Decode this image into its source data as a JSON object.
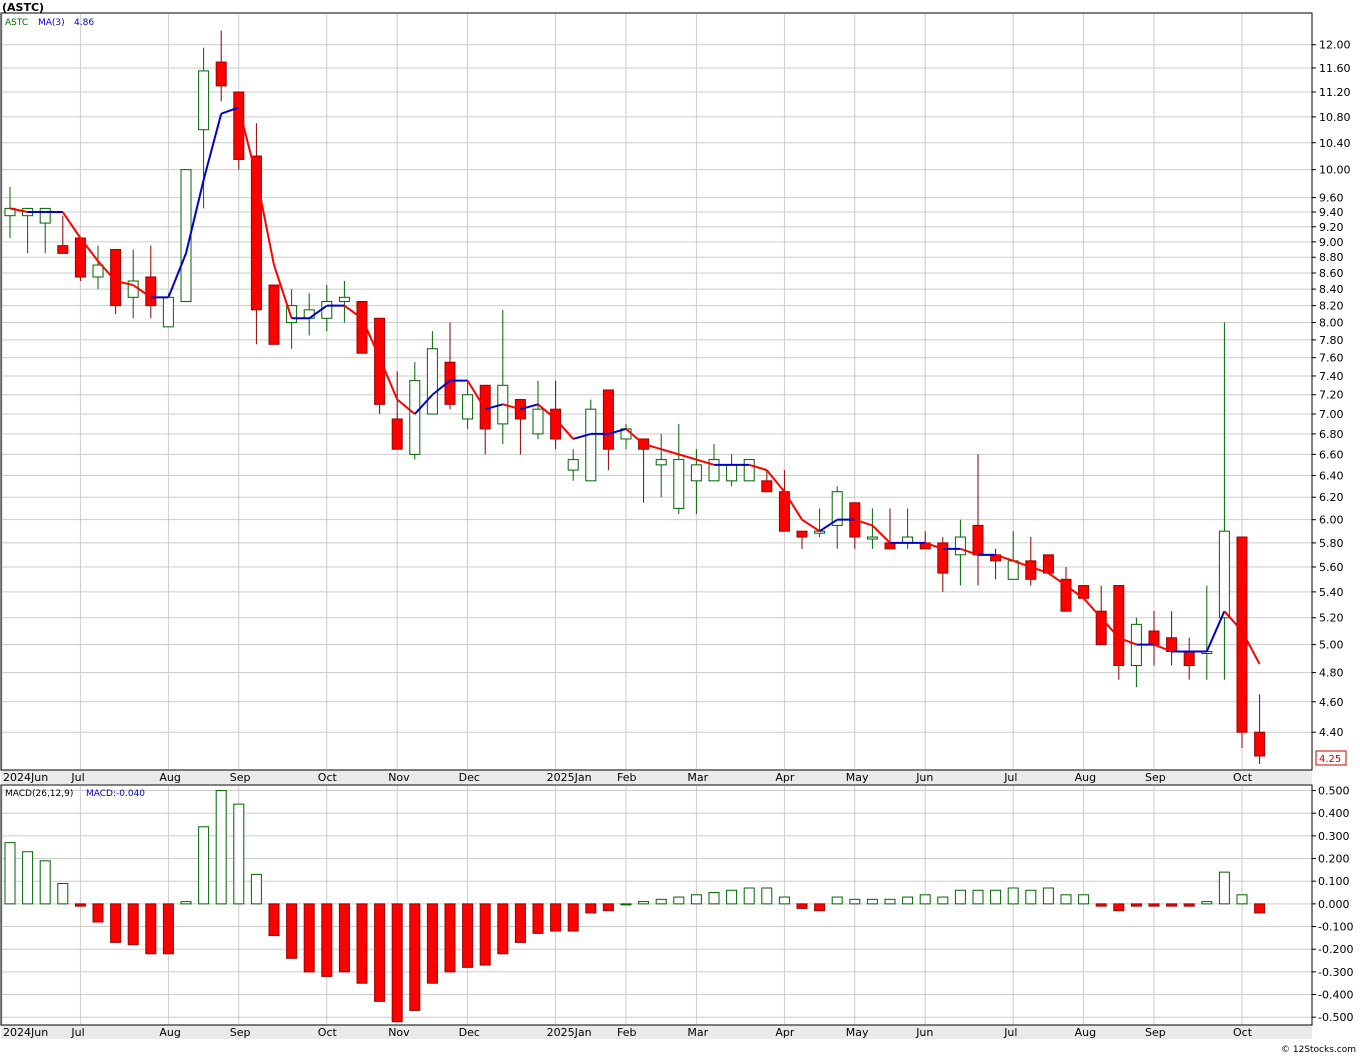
{
  "header": {
    "symbol_title": "(ASTC)",
    "legend_symbol": "ASTC",
    "legend_ma": "MA(3)",
    "legend_ma_value": "4.86",
    "last_price_label": "4.25"
  },
  "macd_header": {
    "label": "MACD(26,12,9)",
    "value_label": "MACD:-0.040"
  },
  "footer": {
    "watermark": "© 12Stocks.com"
  },
  "colors": {
    "up_candle": "#006400",
    "down_candle": "#ff0000",
    "ma_up": "#0000cc",
    "ma_down": "#ff0000",
    "grid": "#cccccc",
    "axis_band": "#eaeaea"
  },
  "chart_data": [
    {
      "type": "candlestick",
      "title": "(ASTC)",
      "series": [
        {
          "name": "ASTC",
          "ohlc": [
            [
              9.35,
              9.75,
              9.05,
              9.45
            ],
            [
              9.35,
              9.45,
              8.85,
              9.45
            ],
            [
              9.25,
              9.45,
              8.85,
              9.45
            ],
            [
              8.95,
              9.35,
              8.9,
              8.85
            ],
            [
              9.05,
              9.05,
              8.5,
              8.55
            ],
            [
              8.55,
              8.95,
              8.4,
              8.7
            ],
            [
              8.9,
              8.9,
              8.1,
              8.2
            ],
            [
              8.3,
              8.9,
              8.05,
              8.5
            ],
            [
              8.55,
              8.95,
              8.05,
              8.2
            ],
            [
              7.95,
              8.35,
              7.95,
              8.3
            ],
            [
              8.25,
              10.0,
              8.25,
              10.0
            ],
            [
              10.6,
              11.95,
              9.45,
              11.55
            ],
            [
              11.7,
              12.25,
              11.05,
              11.3
            ],
            [
              11.2,
              11.2,
              10.0,
              10.15
            ],
            [
              10.2,
              10.7,
              7.75,
              8.15
            ],
            [
              8.45,
              8.45,
              7.75,
              7.75
            ],
            [
              8.0,
              8.4,
              7.7,
              8.2
            ],
            [
              8.05,
              8.35,
              7.85,
              8.15
            ],
            [
              8.05,
              8.45,
              7.9,
              8.25
            ],
            [
              8.25,
              8.5,
              8.0,
              8.3
            ],
            [
              8.25,
              8.25,
              7.65,
              7.65
            ],
            [
              8.05,
              8.05,
              7.0,
              7.1
            ],
            [
              6.95,
              7.45,
              6.65,
              6.65
            ],
            [
              6.6,
              7.55,
              6.55,
              7.35
            ],
            [
              7.0,
              7.9,
              7.0,
              7.7
            ],
            [
              7.55,
              8.0,
              7.05,
              7.1
            ],
            [
              6.95,
              7.35,
              6.85,
              7.2
            ],
            [
              7.3,
              7.3,
              6.6,
              6.85
            ],
            [
              6.9,
              8.15,
              6.7,
              7.3
            ],
            [
              7.15,
              7.15,
              6.6,
              6.95
            ],
            [
              6.8,
              7.35,
              6.75,
              7.05
            ],
            [
              7.05,
              7.35,
              6.65,
              6.75
            ],
            [
              6.45,
              6.65,
              6.35,
              6.55
            ],
            [
              6.35,
              7.15,
              6.35,
              7.05
            ],
            [
              7.25,
              7.25,
              6.45,
              6.65
            ],
            [
              6.75,
              6.9,
              6.65,
              6.85
            ],
            [
              6.75,
              6.75,
              6.15,
              6.65
            ],
            [
              6.5,
              6.8,
              6.2,
              6.55
            ],
            [
              6.1,
              6.9,
              6.05,
              6.55
            ],
            [
              6.35,
              6.65,
              6.05,
              6.5
            ],
            [
              6.35,
              6.7,
              6.35,
              6.55
            ],
            [
              6.35,
              6.6,
              6.3,
              6.5
            ],
            [
              6.35,
              6.55,
              6.35,
              6.55
            ],
            [
              6.35,
              6.45,
              6.25,
              6.25
            ],
            [
              6.25,
              6.45,
              5.9,
              5.9
            ],
            [
              5.9,
              5.9,
              5.75,
              5.85
            ],
            [
              5.9,
              6.1,
              5.85,
              5.9
            ],
            [
              5.95,
              6.3,
              5.75,
              6.25
            ],
            [
              6.15,
              6.15,
              5.75,
              5.85
            ],
            [
              5.85,
              6.1,
              5.75,
              5.85
            ],
            [
              5.8,
              6.1,
              5.75,
              5.75
            ],
            [
              5.8,
              6.1,
              5.75,
              5.85
            ],
            [
              5.8,
              5.9,
              5.75,
              5.75
            ],
            [
              5.8,
              5.85,
              5.4,
              5.55
            ],
            [
              5.7,
              6.0,
              5.45,
              5.85
            ],
            [
              5.95,
              6.6,
              5.45,
              5.7
            ],
            [
              5.7,
              5.75,
              5.5,
              5.65
            ],
            [
              5.5,
              5.9,
              5.5,
              5.65
            ],
            [
              5.65,
              5.85,
              5.45,
              5.5
            ],
            [
              5.7,
              5.7,
              5.55,
              5.55
            ],
            [
              5.5,
              5.6,
              5.25,
              5.25
            ],
            [
              5.45,
              5.45,
              5.35,
              5.35
            ],
            [
              5.25,
              5.45,
              5.0,
              5.0
            ],
            [
              5.45,
              5.45,
              4.75,
              4.85
            ],
            [
              4.85,
              5.2,
              4.7,
              5.15
            ],
            [
              5.1,
              5.25,
              4.85,
              5.0
            ],
            [
              5.05,
              5.25,
              4.85,
              4.95
            ],
            [
              4.95,
              5.05,
              4.75,
              4.85
            ],
            [
              4.95,
              5.45,
              4.75,
              4.95
            ],
            [
              5.2,
              8.0,
              4.75,
              5.9
            ],
            [
              5.85,
              5.85,
              4.3,
              4.4
            ],
            [
              4.4,
              4.65,
              4.2,
              4.25
            ]
          ]
        },
        {
          "name": "MA(3)",
          "values": [
            9.45,
            9.4,
            9.4,
            9.4,
            9.05,
            8.75,
            8.5,
            8.45,
            8.3,
            8.3,
            8.85,
            9.85,
            10.85,
            10.95,
            9.9,
            8.7,
            8.05,
            8.05,
            8.2,
            8.2,
            8.05,
            7.6,
            7.15,
            7.0,
            7.2,
            7.35,
            7.35,
            7.05,
            7.1,
            7.05,
            7.1,
            6.95,
            6.75,
            6.8,
            6.8,
            6.85,
            6.7,
            6.65,
            6.6,
            6.55,
            6.5,
            6.5,
            6.5,
            6.45,
            6.25,
            6.0,
            5.9,
            6.0,
            6.0,
            5.95,
            5.8,
            5.8,
            5.8,
            5.75,
            5.75,
            5.7,
            5.7,
            5.65,
            5.6,
            5.55,
            5.45,
            5.35,
            5.2,
            5.05,
            5.0,
            5.0,
            4.95,
            4.95,
            4.95,
            5.25,
            5.1,
            4.86
          ]
        }
      ],
      "yaxis_ticks": [
        "12.00",
        "11.60",
        "11.20",
        "10.80",
        "10.40",
        "10.00",
        "9.60",
        "9.40",
        "9.20",
        "9.00",
        "8.80",
        "8.60",
        "8.40",
        "8.20",
        "8.00",
        "7.80",
        "7.60",
        "7.40",
        "7.20",
        "7.00",
        "6.80",
        "6.60",
        "6.40",
        "6.20",
        "6.00",
        "5.80",
        "5.60",
        "5.40",
        "5.20",
        "5.00",
        "4.80",
        "4.60",
        "4.40"
      ],
      "y_scale": "log",
      "ylim": [
        4.17,
        12.55
      ],
      "grid": true
    },
    {
      "type": "bar",
      "title": "MACD(26,12,9)",
      "values": [
        0.27,
        0.23,
        0.19,
        0.09,
        -0.01,
        -0.08,
        -0.17,
        -0.18,
        -0.22,
        -0.22,
        0.01,
        0.34,
        0.5,
        0.44,
        0.13,
        -0.14,
        -0.24,
        -0.3,
        -0.32,
        -0.3,
        -0.35,
        -0.43,
        -0.52,
        -0.47,
        -0.35,
        -0.3,
        -0.28,
        -0.27,
        -0.22,
        -0.17,
        -0.13,
        -0.12,
        -0.12,
        -0.04,
        -0.03,
        0.0,
        0.01,
        0.02,
        0.03,
        0.04,
        0.05,
        0.06,
        0.07,
        0.07,
        0.03,
        -0.02,
        -0.03,
        0.03,
        0.02,
        0.02,
        0.02,
        0.03,
        0.04,
        0.03,
        0.06,
        0.06,
        0.06,
        0.07,
        0.06,
        0.07,
        0.04,
        0.04,
        -0.01,
        -0.03,
        -0.01,
        -0.01,
        -0.01,
        -0.01,
        0.01,
        0.14,
        0.04,
        -0.04
      ],
      "yaxis_ticks": [
        "0.500",
        "0.400",
        "0.300",
        "0.200",
        "0.100",
        "0.000",
        "-0.100",
        "-0.200",
        "-0.300",
        "-0.400",
        "-0.500"
      ],
      "ylim": [
        -0.53,
        0.52
      ],
      "grid": true
    }
  ],
  "x_axis": {
    "labels": [
      {
        "label": "2024Jun",
        "index": 0
      },
      {
        "label": "Jul",
        "index": 4
      },
      {
        "label": "Aug",
        "index": 9
      },
      {
        "label": "Sep",
        "index": 13
      },
      {
        "label": "Oct",
        "index": 18
      },
      {
        "label": "Nov",
        "index": 22
      },
      {
        "label": "Dec",
        "index": 26
      },
      {
        "label": "2025Jan",
        "index": 31
      },
      {
        "label": "Feb",
        "index": 35
      },
      {
        "label": "Mar",
        "index": 39
      },
      {
        "label": "Apr",
        "index": 44
      },
      {
        "label": "May",
        "index": 48
      },
      {
        "label": "Jun",
        "index": 52
      },
      {
        "label": "Jul",
        "index": 57
      },
      {
        "label": "Aug",
        "index": 61
      },
      {
        "label": "Sep",
        "index": 65
      },
      {
        "label": "Oct",
        "index": 70
      }
    ]
  }
}
